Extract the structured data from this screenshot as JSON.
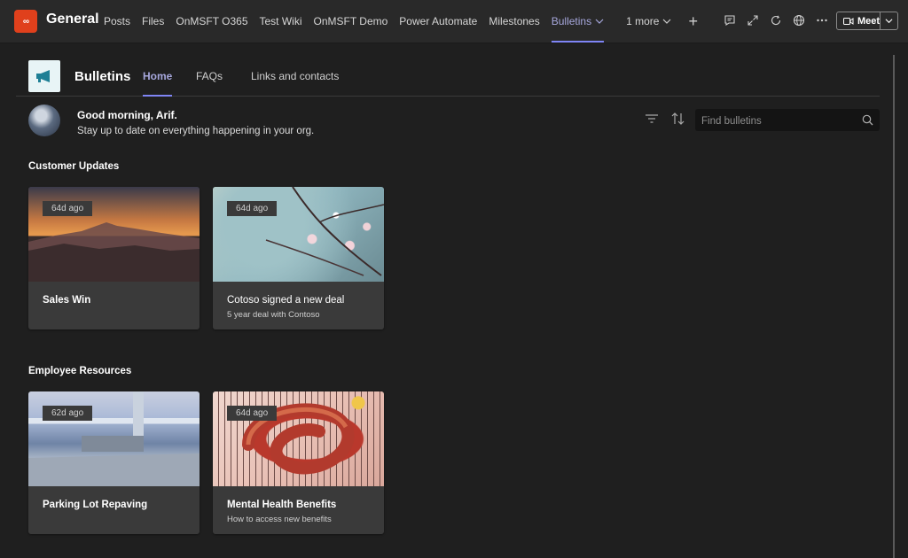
{
  "team": {
    "avatar_text": "∞",
    "channel_name": "General"
  },
  "tabs": [
    {
      "label": "Posts",
      "active": false
    },
    {
      "label": "Files",
      "active": false
    },
    {
      "label": "OnMSFT O365",
      "active": false
    },
    {
      "label": "Test Wiki",
      "active": false
    },
    {
      "label": "OnMSFT Demo",
      "active": false
    },
    {
      "label": "Power Automate",
      "active": false
    },
    {
      "label": "Milestones",
      "active": false
    },
    {
      "label": "Bulletins",
      "active": true
    },
    {
      "label": "1 more",
      "active": false
    }
  ],
  "meet": {
    "label": "Meet"
  },
  "app": {
    "title": "Bulletins",
    "tabs": [
      {
        "label": "Home",
        "active": true
      },
      {
        "label": "FAQs",
        "active": false
      },
      {
        "label": "Links and contacts",
        "active": false
      }
    ]
  },
  "greeting": {
    "title": "Good morning, Arif.",
    "subtitle": "Stay up to date on everything happening in your org."
  },
  "search": {
    "placeholder": "Find bulletins"
  },
  "sections": [
    {
      "title": "Customer Updates",
      "cards": [
        {
          "badge": "64d ago",
          "title": "Sales Win",
          "subtitle": ""
        },
        {
          "badge": "64d ago",
          "title": "Cotoso signed a new deal",
          "subtitle": "5 year deal with Contoso"
        }
      ]
    },
    {
      "title": "Employee Resources",
      "cards": [
        {
          "badge": "62d ago",
          "title": "Parking Lot Repaving",
          "subtitle": ""
        },
        {
          "badge": "64d ago",
          "title": "Mental Health Benefits",
          "subtitle": "How to access new benefits"
        }
      ]
    }
  ],
  "colors": {
    "accent": "#7f85f5",
    "team_avatar": "#e0401c",
    "background": "#1f1f1f",
    "card": "#3a3a3a"
  }
}
